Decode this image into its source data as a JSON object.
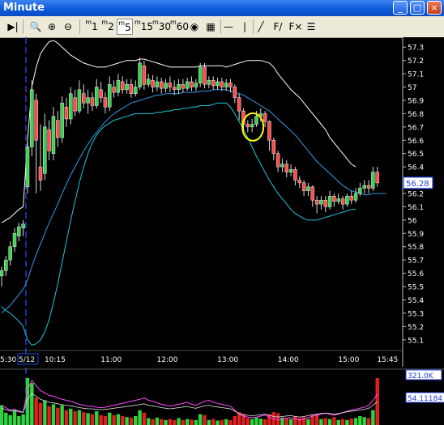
{
  "window": {
    "title": "Minute",
    "buttons": [
      "minimize",
      "maximize",
      "close"
    ]
  },
  "toolbar": {
    "items": [
      {
        "name": "play-end",
        "glyph": "▶|"
      },
      {
        "name": "zoom-fit",
        "glyph": "🔍"
      },
      {
        "name": "zoom-in",
        "glyph": "⊕"
      },
      {
        "name": "zoom-out",
        "glyph": "⊖"
      },
      {
        "name": "interval-1",
        "label": "1",
        "sup": "m",
        "selected": false
      },
      {
        "name": "interval-2",
        "label": "2",
        "sup": "m",
        "selected": false
      },
      {
        "name": "interval-5",
        "label": "5",
        "sup": "m",
        "selected": true
      },
      {
        "name": "interval-15",
        "label": "15",
        "sup": "m",
        "selected": false
      },
      {
        "name": "interval-30",
        "label": "30",
        "sup": "m",
        "selected": false
      },
      {
        "name": "interval-60",
        "label": "60",
        "sup": "m",
        "selected": false
      },
      {
        "name": "globe",
        "glyph": "◉"
      },
      {
        "name": "calculator",
        "glyph": "▦"
      },
      {
        "name": "hline-tool",
        "glyph": "—"
      },
      {
        "name": "vline-tool",
        "glyph": "|"
      },
      {
        "name": "trendline-tool",
        "glyph": "╱"
      },
      {
        "name": "fib-tool",
        "glyph": "F/"
      },
      {
        "name": "indicator-tool",
        "glyph": "F×"
      },
      {
        "name": "list-tool",
        "glyph": "☰"
      }
    ]
  },
  "chart_data": {
    "type": "candlestick",
    "interval": "5 min",
    "price_axis": {
      "ylim": [
        55.05,
        57.35
      ],
      "ticks": [
        "57.3",
        "57.2",
        "57.1",
        "57",
        "56.9",
        "56.8",
        "56.7",
        "56.6",
        "56.5",
        "56.4",
        "56.3",
        "56.2",
        "56.1",
        "56",
        "55.9",
        "55.8",
        "55.7",
        "55.6",
        "55.5",
        "55.4",
        "55.3",
        "55.2",
        "55.1"
      ],
      "tick_values": [
        57.3,
        57.2,
        57.1,
        57.0,
        56.9,
        56.8,
        56.7,
        56.6,
        56.5,
        56.4,
        56.3,
        56.2,
        56.1,
        56.0,
        55.9,
        55.8,
        55.7,
        55.6,
        55.5,
        55.4,
        55.3,
        55.2,
        55.1
      ],
      "last_price_label": "56.28",
      "last_price": 56.28
    },
    "time_axis": {
      "labels": [
        "5:30",
        "5/12",
        "10:15",
        "11:00",
        "12:00",
        "13:00",
        "14:00",
        "15:00",
        "15:45"
      ],
      "label_index": [
        0,
        6,
        12,
        25,
        38,
        52,
        66,
        80,
        89
      ],
      "highlighted": "5/12",
      "session_break_index": 6
    },
    "candles": [
      [
        55.58,
        55.62,
        55.5,
        55.65
      ],
      [
        55.62,
        55.7,
        55.58,
        55.73
      ],
      [
        55.7,
        55.8,
        55.66,
        55.84
      ],
      [
        55.8,
        55.9,
        55.76,
        55.94
      ],
      [
        55.88,
        55.95,
        55.84,
        55.98
      ],
      [
        55.94,
        55.97,
        55.88,
        56.0
      ],
      [
        56.25,
        56.55,
        56.2,
        56.62
      ],
      [
        56.55,
        56.98,
        56.48,
        57.05
      ],
      [
        56.9,
        56.6,
        56.2,
        56.95
      ],
      [
        56.4,
        56.3,
        56.22,
        56.72
      ],
      [
        56.35,
        56.7,
        56.3,
        56.8
      ],
      [
        56.68,
        56.52,
        56.45,
        56.75
      ],
      [
        56.5,
        56.78,
        56.45,
        56.85
      ],
      [
        56.75,
        56.62,
        56.55,
        56.82
      ],
      [
        56.62,
        56.88,
        56.58,
        56.93
      ],
      [
        56.85,
        56.76,
        56.7,
        56.92
      ],
      [
        56.76,
        56.95,
        56.72,
        57.0
      ],
      [
        56.92,
        56.82,
        56.78,
        56.98
      ],
      [
        56.82,
        56.98,
        56.8,
        57.05
      ],
      [
        56.95,
        56.88,
        56.84,
        57.02
      ],
      [
        56.88,
        56.92,
        56.8,
        56.98
      ],
      [
        56.92,
        56.86,
        56.82,
        56.96
      ],
      [
        56.86,
        57.0,
        56.84,
        57.06
      ],
      [
        56.98,
        56.92,
        56.88,
        57.04
      ],
      [
        56.92,
        56.85,
        56.8,
        56.96
      ],
      [
        56.85,
        57.02,
        56.82,
        57.08
      ],
      [
        57.0,
        56.96,
        56.92,
        57.05
      ],
      [
        56.96,
        57.05,
        56.93,
        57.1
      ],
      [
        57.04,
        56.98,
        56.95,
        57.08
      ],
      [
        56.98,
        57.02,
        56.95,
        57.06
      ],
      [
        57.02,
        56.95,
        56.92,
        57.06
      ],
      [
        56.95,
        57.0,
        56.93,
        57.05
      ],
      [
        57.0,
        57.18,
        56.98,
        57.22
      ],
      [
        57.16,
        57.02,
        56.98,
        57.2
      ],
      [
        57.02,
        57.06,
        57.0,
        57.1
      ],
      [
        57.05,
        57.0,
        56.96,
        57.09
      ],
      [
        57.0,
        57.04,
        56.97,
        57.08
      ],
      [
        57.04,
        56.99,
        56.95,
        57.07
      ],
      [
        56.99,
        57.03,
        56.96,
        57.06
      ],
      [
        57.03,
        57.0,
        56.96,
        57.08
      ],
      [
        57.0,
        56.98,
        56.94,
        57.05
      ],
      [
        56.98,
        57.02,
        56.95,
        57.06
      ],
      [
        57.02,
        56.99,
        56.96,
        57.06
      ],
      [
        56.99,
        57.04,
        56.97,
        57.07
      ],
      [
        57.04,
        57.0,
        56.97,
        57.08
      ],
      [
        57.0,
        57.03,
        56.97,
        57.06
      ],
      [
        57.03,
        57.15,
        57.0,
        57.18
      ],
      [
        57.15,
        57.02,
        56.99,
        57.18
      ],
      [
        57.02,
        57.05,
        56.99,
        57.08
      ],
      [
        57.05,
        57.01,
        56.98,
        57.08
      ],
      [
        57.01,
        57.04,
        56.98,
        57.07
      ],
      [
        57.04,
        57.0,
        56.97,
        57.07
      ],
      [
        57.0,
        57.03,
        56.97,
        57.06
      ],
      [
        57.03,
        57.0,
        56.96,
        57.06
      ],
      [
        57.0,
        56.92,
        56.88,
        57.02
      ],
      [
        56.92,
        56.82,
        56.75,
        56.95
      ],
      [
        56.82,
        56.72,
        56.65,
        56.84
      ],
      [
        56.72,
        56.7,
        56.66,
        56.75
      ],
      [
        56.7,
        56.72,
        56.66,
        56.76
      ],
      [
        56.72,
        56.78,
        56.7,
        56.82
      ],
      [
        56.78,
        56.8,
        56.74,
        56.84
      ],
      [
        56.8,
        56.74,
        56.7,
        56.82
      ],
      [
        56.74,
        56.6,
        56.52,
        56.75
      ],
      [
        56.6,
        56.5,
        56.45,
        56.62
      ],
      [
        56.5,
        56.4,
        56.36,
        56.52
      ],
      [
        56.4,
        56.42,
        56.36,
        56.46
      ],
      [
        56.42,
        56.36,
        56.32,
        56.45
      ],
      [
        56.36,
        56.38,
        56.33,
        56.42
      ],
      [
        56.38,
        56.3,
        56.26,
        56.4
      ],
      [
        56.3,
        56.28,
        56.24,
        56.33
      ],
      [
        56.28,
        56.22,
        56.18,
        56.3
      ],
      [
        56.22,
        56.25,
        56.18,
        56.28
      ],
      [
        56.25,
        56.15,
        56.1,
        56.26
      ],
      [
        56.15,
        56.12,
        56.05,
        56.18
      ],
      [
        56.12,
        56.15,
        56.08,
        56.18
      ],
      [
        56.15,
        56.1,
        56.06,
        56.18
      ],
      [
        56.1,
        56.18,
        56.08,
        56.22
      ],
      [
        56.18,
        56.14,
        56.1,
        56.2
      ],
      [
        56.14,
        56.16,
        56.12,
        56.2
      ],
      [
        56.16,
        56.12,
        56.08,
        56.18
      ],
      [
        56.12,
        56.18,
        56.1,
        56.2
      ],
      [
        56.18,
        56.15,
        56.12,
        56.22
      ],
      [
        56.15,
        56.2,
        56.13,
        56.24
      ],
      [
        56.2,
        56.24,
        56.18,
        56.28
      ],
      [
        56.24,
        56.26,
        56.2,
        56.3
      ],
      [
        56.26,
        56.24,
        56.2,
        56.3
      ],
      [
        56.24,
        56.36,
        56.22,
        56.4
      ],
      [
        56.36,
        56.28,
        56.25,
        56.4
      ]
    ],
    "candle_fields": [
      "open",
      "close",
      "low",
      "high"
    ],
    "series": [
      {
        "kind": "upper_band",
        "color": "#ffffff",
        "values": [
          55.98,
          56.0,
          56.02,
          56.05,
          56.08,
          56.1,
          56.6,
          57.0,
          57.15,
          57.25,
          57.3,
          57.34,
          57.35,
          57.33,
          57.3,
          57.27,
          57.24,
          57.22,
          57.2,
          57.18,
          57.17,
          57.16,
          57.15,
          57.15,
          57.15,
          57.16,
          57.17,
          57.18,
          57.19,
          57.2,
          57.2,
          57.2,
          57.21,
          57.21,
          57.2,
          57.19,
          57.18,
          57.17,
          57.16,
          57.15,
          57.15,
          57.15,
          57.15,
          57.15,
          57.15,
          57.15,
          57.16,
          57.16,
          57.16,
          57.16,
          57.16,
          57.16,
          57.15,
          57.16,
          57.17,
          57.18,
          57.19,
          57.2,
          57.2,
          57.2,
          57.2,
          57.19,
          57.18,
          57.15,
          57.1,
          57.06,
          57.02,
          56.98,
          56.95,
          56.92,
          56.88,
          56.84,
          56.8,
          56.76,
          56.72,
          56.68,
          56.62,
          56.58,
          56.54,
          56.5,
          56.46,
          56.42,
          56.4
        ]
      },
      {
        "kind": "moving_average",
        "color": "#2f9be8",
        "values": [
          55.3,
          55.33,
          55.36,
          55.4,
          55.44,
          55.48,
          55.55,
          55.65,
          55.74,
          55.82,
          55.9,
          55.98,
          56.05,
          56.12,
          56.2,
          56.27,
          56.34,
          56.4,
          56.46,
          56.52,
          56.57,
          56.62,
          56.66,
          56.7,
          56.74,
          56.77,
          56.8,
          56.82,
          56.84,
          56.86,
          56.88,
          56.89,
          56.9,
          56.91,
          56.92,
          56.93,
          56.94,
          56.94,
          56.95,
          56.95,
          56.95,
          56.95,
          56.96,
          56.96,
          56.96,
          56.96,
          56.97,
          56.97,
          56.97,
          56.98,
          56.98,
          56.98,
          56.98,
          56.97,
          56.96,
          56.95,
          56.94,
          56.92,
          56.9,
          56.88,
          56.86,
          56.84,
          56.82,
          56.79,
          56.76,
          56.73,
          56.7,
          56.67,
          56.64,
          56.6,
          56.56,
          56.52,
          56.48,
          56.44,
          56.41,
          56.38,
          56.35,
          56.32,
          56.29,
          56.26,
          56.24,
          56.22,
          56.21,
          56.2,
          56.19,
          56.19,
          56.2,
          56.2,
          56.2,
          56.2
        ]
      },
      {
        "kind": "lower_band",
        "color": "#22c7d6",
        "values": [
          55.35,
          55.32,
          55.3,
          55.27,
          55.24,
          55.2,
          55.1,
          55.06,
          55.07,
          55.1,
          55.16,
          55.25,
          55.38,
          55.52,
          55.68,
          55.84,
          56.0,
          56.14,
          56.28,
          56.4,
          56.5,
          56.58,
          56.64,
          56.68,
          56.71,
          56.73,
          56.75,
          56.76,
          56.77,
          56.78,
          56.79,
          56.8,
          56.8,
          56.8,
          56.8,
          56.8,
          56.81,
          56.81,
          56.82,
          56.82,
          56.83,
          56.83,
          56.84,
          56.84,
          56.85,
          56.85,
          56.86,
          56.86,
          56.86,
          56.87,
          56.88,
          56.88,
          56.88,
          56.85,
          56.8,
          56.74,
          56.68,
          56.62,
          56.55,
          56.48,
          56.42,
          56.36,
          56.3,
          56.25,
          56.2,
          56.16,
          56.12,
          56.08,
          56.05,
          56.03,
          56.01,
          56.0,
          56.0,
          56.0,
          56.01,
          56.02,
          56.03,
          56.04,
          56.05,
          56.06,
          56.07,
          56.08,
          56.08
        ]
      }
    ],
    "annotation": {
      "type": "circle",
      "color": "#ffff00",
      "center_index": 58,
      "center_price": 56.7
    },
    "volume_panel": {
      "labels": [
        "321.0K",
        "54.11184"
      ],
      "volumes": [
        0.4,
        0.25,
        0.2,
        0.3,
        0.18,
        0.22,
        0.95,
        0.85,
        0.55,
        0.45,
        0.5,
        0.38,
        0.42,
        0.35,
        0.4,
        0.3,
        0.33,
        0.28,
        0.3,
        0.26,
        0.24,
        0.22,
        0.28,
        0.2,
        0.18,
        0.25,
        0.2,
        0.22,
        0.18,
        0.16,
        0.15,
        0.18,
        0.3,
        0.25,
        0.14,
        0.12,
        0.15,
        0.12,
        0.1,
        0.12,
        0.1,
        0.14,
        0.1,
        0.12,
        0.11,
        0.1,
        0.22,
        0.2,
        0.1,
        0.12,
        0.09,
        0.1,
        0.12,
        0.1,
        0.18,
        0.26,
        0.22,
        0.14,
        0.12,
        0.15,
        0.13,
        0.12,
        0.22,
        0.26,
        0.24,
        0.15,
        0.14,
        0.12,
        0.18,
        0.14,
        0.16,
        0.12,
        0.2,
        0.22,
        0.12,
        0.14,
        0.12,
        0.16,
        0.1,
        0.12,
        0.1,
        0.13,
        0.14,
        0.18,
        0.16,
        0.14,
        0.3,
        0.95
      ],
      "indicator": [
        0.4,
        0.35,
        0.3,
        0.32,
        0.28,
        0.26,
        0.7,
        0.9,
        0.8,
        0.7,
        0.65,
        0.6,
        0.58,
        0.55,
        0.52,
        0.5,
        0.48,
        0.45,
        0.42,
        0.4,
        0.38,
        0.38,
        0.36,
        0.35,
        0.36,
        0.38,
        0.4,
        0.42,
        0.44,
        0.46,
        0.48,
        0.5,
        0.52,
        0.55,
        0.5,
        0.48,
        0.45,
        0.42,
        0.4,
        0.38,
        0.4,
        0.42,
        0.44,
        0.46,
        0.42,
        0.4,
        0.44,
        0.48,
        0.5,
        0.46,
        0.44,
        0.42,
        0.4,
        0.38,
        0.3,
        0.22,
        0.18,
        0.16,
        0.15,
        0.16,
        0.18,
        0.2,
        0.16,
        0.12,
        0.1,
        0.12,
        0.14,
        0.15,
        0.12,
        0.1,
        0.12,
        0.15,
        0.18,
        0.2,
        0.22,
        0.24,
        0.22,
        0.2,
        0.22,
        0.25,
        0.28,
        0.3,
        0.32,
        0.34,
        0.36,
        0.4,
        0.5,
        0.62
      ]
    }
  }
}
